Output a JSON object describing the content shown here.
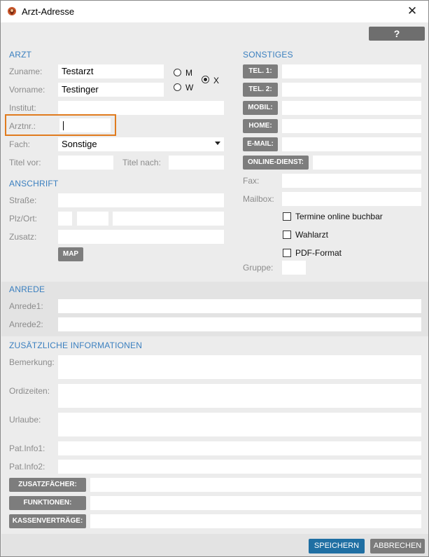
{
  "window": {
    "title": "Arzt-Adresse",
    "close_glyph": "✕",
    "help_label": "?"
  },
  "arzt": {
    "header": "ARZT",
    "zuname_label": "Zuname:",
    "zuname_value": "Testarzt",
    "vorname_label": "Vorname:",
    "vorname_value": "Testinger",
    "institut_label": "Institut:",
    "institut_value": "",
    "arztnr_label": "Arztnr.:",
    "arztnr_value": "",
    "fach_label": "Fach:",
    "fach_value": "Sonstige",
    "titel_vor_label": "Titel vor:",
    "titel_vor_value": "",
    "titel_nach_label": "Titel nach:",
    "titel_nach_value": "",
    "gender_m": "M",
    "gender_w": "W",
    "gender_x": "X",
    "gender_selected": "X"
  },
  "anschrift": {
    "header": "ANSCHRIFT",
    "strasse_label": "Straße:",
    "plzort_label": "Plz/Ort:",
    "zusatz_label": "Zusatz:",
    "map_button": "MAP"
  },
  "sonstiges": {
    "header": "SONSTIGES",
    "tel1_button": "TEL. 1:",
    "tel2_button": "TEL. 2:",
    "mobil_button": "MOBIL:",
    "home_button": "HOME:",
    "email_button": "E-MAIL:",
    "online_button": "ONLINE-DIENST:",
    "fax_label": "Fax:",
    "mailbox_label": "Mailbox:",
    "termine_label": "Termine online buchbar",
    "wahlarzt_label": "Wahlarzt",
    "pdf_label": "PDF-Format",
    "gruppe_label": "Gruppe:"
  },
  "anrede": {
    "header": "ANREDE",
    "anrede1_label": "Anrede1:",
    "anrede2_label": "Anrede2:"
  },
  "zusatz_info": {
    "header": "ZUSÄTZLICHE INFORMATIONEN",
    "bemerkung_label": "Bemerkung:",
    "ordizeiten_label": "Ordizeiten:",
    "urlaube_label": "Urlaube:",
    "patinfo1_label": "Pat.Info1:",
    "patinfo2_label": "Pat.Info2:",
    "zusatzfaecher_button": "ZUSATZFÄCHER:",
    "funktionen_button": "FUNKTIONEN:",
    "kassenvertraege_button": "KASSENVERTRÄGE:"
  },
  "footer": {
    "save_button": "SPEICHERN",
    "cancel_button": "ABBRECHEN"
  },
  "colors": {
    "section_header": "#3a7fbf",
    "highlight": "#e07b1e",
    "save_button": "#1f6fa3"
  }
}
